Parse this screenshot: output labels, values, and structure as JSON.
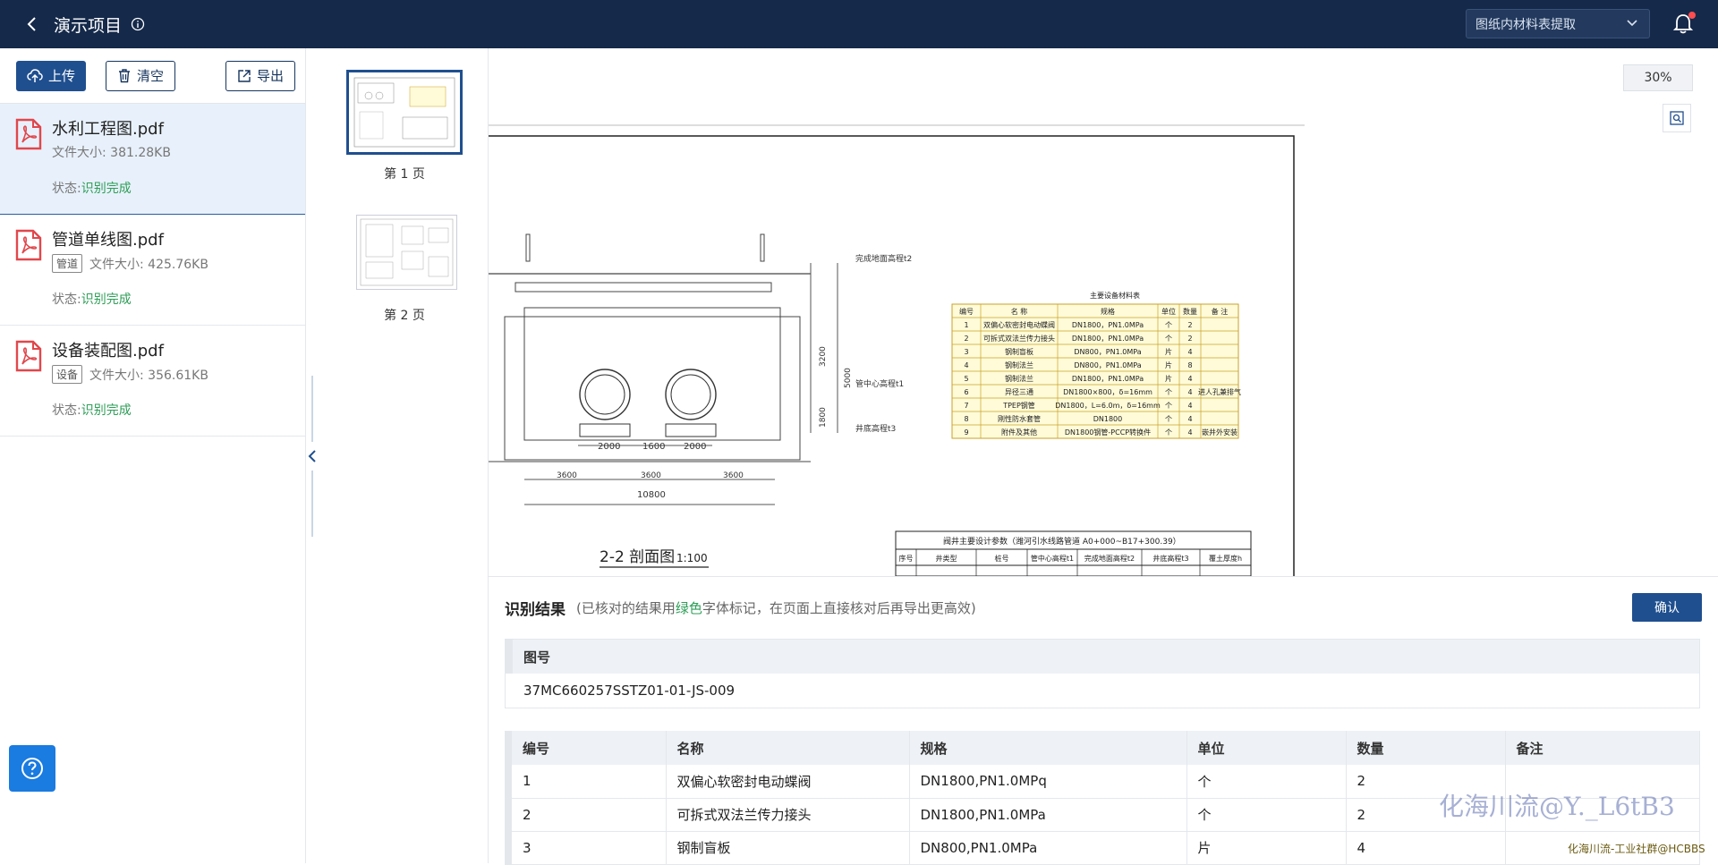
{
  "header": {
    "title": "演示项目",
    "mode_select": "图纸内材料表提取"
  },
  "toolbar": {
    "upload_label": "上传",
    "clear_label": "清空",
    "export_label": "导出"
  },
  "files": [
    {
      "name": "水利工程图.pdf",
      "tag": "",
      "size": "文件大小: 381.28KB",
      "status_prefix": "状态:",
      "status": "识别完成"
    },
    {
      "name": "管道单线图.pdf",
      "tag": "管道",
      "size": "文件大小: 425.76KB",
      "status_prefix": "状态:",
      "status": "识别完成"
    },
    {
      "name": "设备装配图.pdf",
      "tag": "设备",
      "size": "文件大小: 356.61KB",
      "status_prefix": "状态:",
      "status": "识别完成"
    }
  ],
  "thumbnails": [
    {
      "label": "第 1 页"
    },
    {
      "label": "第 2 页"
    }
  ],
  "viewer": {
    "zoom": "30%",
    "section_title": "2-2 剖面图",
    "section_scale": "1:100",
    "dims": [
      "2000",
      "1600",
      "2000",
      "3600",
      "3600",
      "3600",
      "10800",
      "3200",
      "5000",
      "1800"
    ],
    "level_labels": [
      "完成地面高程t2",
      "管中心高程t1",
      "井底高程t3"
    ],
    "sheet_table_title": "主要设备材料表",
    "sheet_table_headers": [
      "编号",
      "名 称",
      "规格",
      "单位",
      "数量",
      "备 注"
    ],
    "sheet_table_rows": [
      [
        "1",
        "双偏心软密封电动蝶阀",
        "DN1800，PN1.0MPa",
        "个",
        "2",
        ""
      ],
      [
        "2",
        "可拆式双法兰传力接头",
        "DN1800，PN1.0MPa",
        "个",
        "2",
        ""
      ],
      [
        "3",
        "钢制盲板",
        "DN800，PN1.0MPa",
        "片",
        "4",
        ""
      ],
      [
        "4",
        "钢制法兰",
        "DN800，PN1.0MPa",
        "片",
        "8",
        ""
      ],
      [
        "5",
        "钢制法兰",
        "DN1800，PN1.0MPa",
        "片",
        "4",
        ""
      ],
      [
        "6",
        "异径三通",
        "DN1800×800，δ=16mm",
        "个",
        "4",
        "进人孔兼排气"
      ],
      [
        "7",
        "TPEP钢管",
        "DN1800，L=6.0m，δ=16mm",
        "个",
        "4",
        ""
      ],
      [
        "8",
        "刚性防水套管",
        "DN1800",
        "个",
        "4",
        ""
      ],
      [
        "9",
        "附件及其他",
        "DN1800钢管-PCCP转换件",
        "个",
        "4",
        "嵌井外安装"
      ]
    ],
    "bottom_table_title": "阀井主要设计参数（潍河引水线路管道 A0+000~B17+300.39）",
    "bottom_table_headers": [
      "序号",
      "井类型",
      "桩号",
      "管中心高程t1",
      "完成地面高程t2",
      "井底高程t3",
      "覆土厚度h"
    ]
  },
  "results": {
    "title": "识别结果",
    "hint_pre": "(已核对的结果用",
    "hint_green": "绿色",
    "hint_post": "字体标记，在页面上直接核对后再导出更高效)",
    "confirm_label": "确认",
    "drawing_no_header": "图号",
    "drawing_no_value": "37MC660257SSTZ01-01-JS-009",
    "columns": [
      "编号",
      "名称",
      "规格",
      "单位",
      "数量",
      "备注"
    ],
    "rows": [
      [
        "1",
        "双偏心软密封电动蝶阀",
        "DN1800,PN1.0MPq",
        "个",
        "2",
        ""
      ],
      [
        "2",
        "可拆式双法兰传力接头",
        "DN1800,PN1.0MPa",
        "个",
        "2",
        ""
      ],
      [
        "3",
        "钢制盲板",
        "DN800,PN1.0MPa",
        "片",
        "4",
        ""
      ]
    ]
  },
  "watermark": {
    "main": "化海川流@Y._L6tB3",
    "small": "化海川流-工业社群@HCBBS"
  },
  "colors": {
    "header_bg": "#15294a",
    "accent": "#1f4f8f",
    "status_ok": "#2e9e57",
    "help_btn": "#1a7be0",
    "sheet_table_bg": "#fffbd8",
    "sheet_table_border": "#c9a227"
  }
}
